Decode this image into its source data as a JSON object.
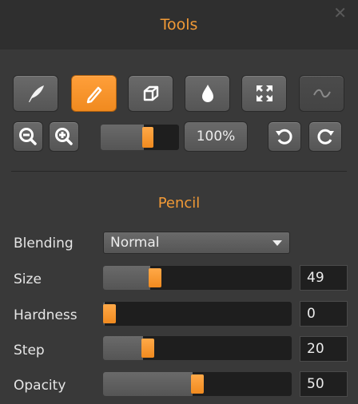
{
  "panel": {
    "title": "Tools",
    "close_icon": "close-icon"
  },
  "toolbar": {
    "tools": [
      {
        "name": "feather-tool",
        "icon": "feather-icon",
        "active": false
      },
      {
        "name": "pencil-tool",
        "icon": "pencil-icon",
        "active": true
      },
      {
        "name": "eraser-tool",
        "icon": "eraser-icon",
        "active": false
      },
      {
        "name": "drop-tool",
        "icon": "drop-icon",
        "active": false
      },
      {
        "name": "transform-tool",
        "icon": "expand-icon",
        "active": false
      },
      {
        "name": "smudge-tool",
        "icon": "wave-icon",
        "active": false,
        "disabled": true
      }
    ]
  },
  "zoom": {
    "value_label": "100%",
    "level_fraction": 0.62
  },
  "section": {
    "title": "Pencil"
  },
  "settings": {
    "blending": {
      "label": "Blending",
      "value": "Normal"
    },
    "sliders": [
      {
        "label": "Size",
        "value": "49",
        "fraction": 0.26
      },
      {
        "label": "Hardness",
        "value": "0",
        "fraction": 0.0
      },
      {
        "label": "Step",
        "value": "20",
        "fraction": 0.22
      },
      {
        "label": "Opacity",
        "value": "50",
        "fraction": 0.5
      }
    ]
  },
  "colors": {
    "accent": "#f29a36",
    "panel_bg": "#393939",
    "title_bg": "#2f2f2f"
  }
}
